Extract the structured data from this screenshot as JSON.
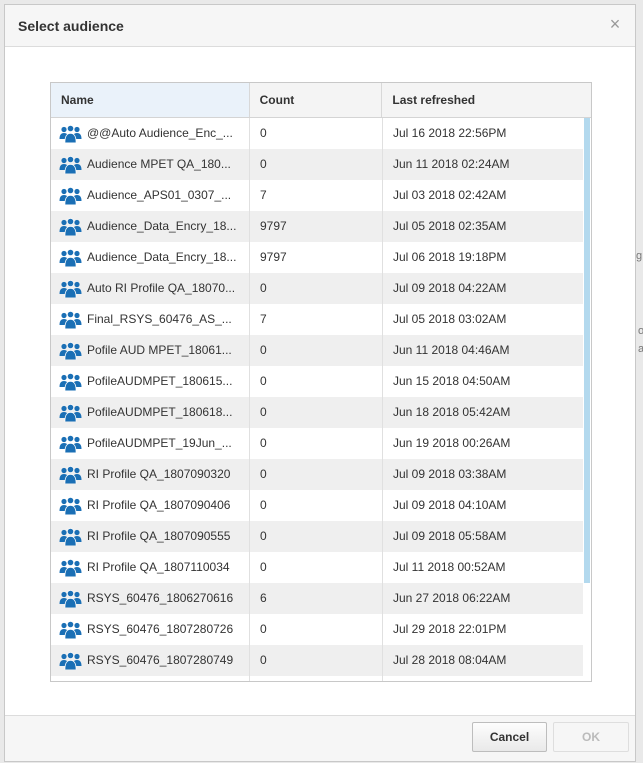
{
  "dialog": {
    "title": "Select audience",
    "close_symbol": "×",
    "cancel_label": "Cancel",
    "ok_label": "OK"
  },
  "table": {
    "headers": {
      "name": "Name",
      "count": "Count",
      "last_refreshed": "Last refreshed"
    },
    "rows": [
      {
        "name": "@@Auto Audience_Enc_...",
        "count": "0",
        "last_refreshed": "Jul 16 2018 22:56PM"
      },
      {
        "name": "Audience MPET QA_180...",
        "count": "0",
        "last_refreshed": "Jun 11 2018 02:24AM"
      },
      {
        "name": "Audience_APS01_0307_...",
        "count": "7",
        "last_refreshed": "Jul 03 2018 02:42AM"
      },
      {
        "name": "Audience_Data_Encry_18...",
        "count": "9797",
        "last_refreshed": "Jul 05 2018 02:35AM"
      },
      {
        "name": "Audience_Data_Encry_18...",
        "count": "9797",
        "last_refreshed": "Jul 06 2018 19:18PM"
      },
      {
        "name": "Auto RI Profile QA_18070...",
        "count": "0",
        "last_refreshed": "Jul 09 2018 04:22AM"
      },
      {
        "name": "Final_RSYS_60476_AS_...",
        "count": "7",
        "last_refreshed": "Jul 05 2018 03:02AM"
      },
      {
        "name": "Pofile AUD MPET_18061...",
        "count": "0",
        "last_refreshed": "Jun 11 2018 04:46AM"
      },
      {
        "name": "PofileAUDMPET_180615...",
        "count": "0",
        "last_refreshed": "Jun 15 2018 04:50AM"
      },
      {
        "name": "PofileAUDMPET_180618...",
        "count": "0",
        "last_refreshed": "Jun 18 2018 05:42AM"
      },
      {
        "name": "PofileAUDMPET_19Jun_...",
        "count": "0",
        "last_refreshed": "Jun 19 2018 00:26AM"
      },
      {
        "name": "RI Profile QA_1807090320",
        "count": "0",
        "last_refreshed": "Jul 09 2018 03:38AM"
      },
      {
        "name": "RI Profile QA_1807090406",
        "count": "0",
        "last_refreshed": "Jul 09 2018 04:10AM"
      },
      {
        "name": "RI Profile QA_1807090555",
        "count": "0",
        "last_refreshed": "Jul 09 2018 05:58AM"
      },
      {
        "name": "RI Profile QA_1807110034",
        "count": "0",
        "last_refreshed": "Jul 11 2018 00:52AM"
      },
      {
        "name": "RSYS_60476_1806270616",
        "count": "6",
        "last_refreshed": "Jun 27 2018 06:22AM"
      },
      {
        "name": "RSYS_60476_1807280726",
        "count": "0",
        "last_refreshed": "Jul 29 2018 22:01PM"
      },
      {
        "name": "RSYS_60476_1807280749",
        "count": "0",
        "last_refreshed": "Jul 28 2018 08:04AM"
      },
      {
        "name": "",
        "count": "",
        "last_refreshed": ""
      }
    ],
    "row_icon": "audience-group-icon"
  },
  "background": {
    "fragment_1": "g",
    "fragment_2": "o",
    "fragment_3": "a"
  },
  "colors": {
    "accent_icon": "#1a6fb5",
    "selected_header": "#eaf2fa",
    "scroll_thumb": "#b3d9ee",
    "row_alt": "#efefef"
  }
}
